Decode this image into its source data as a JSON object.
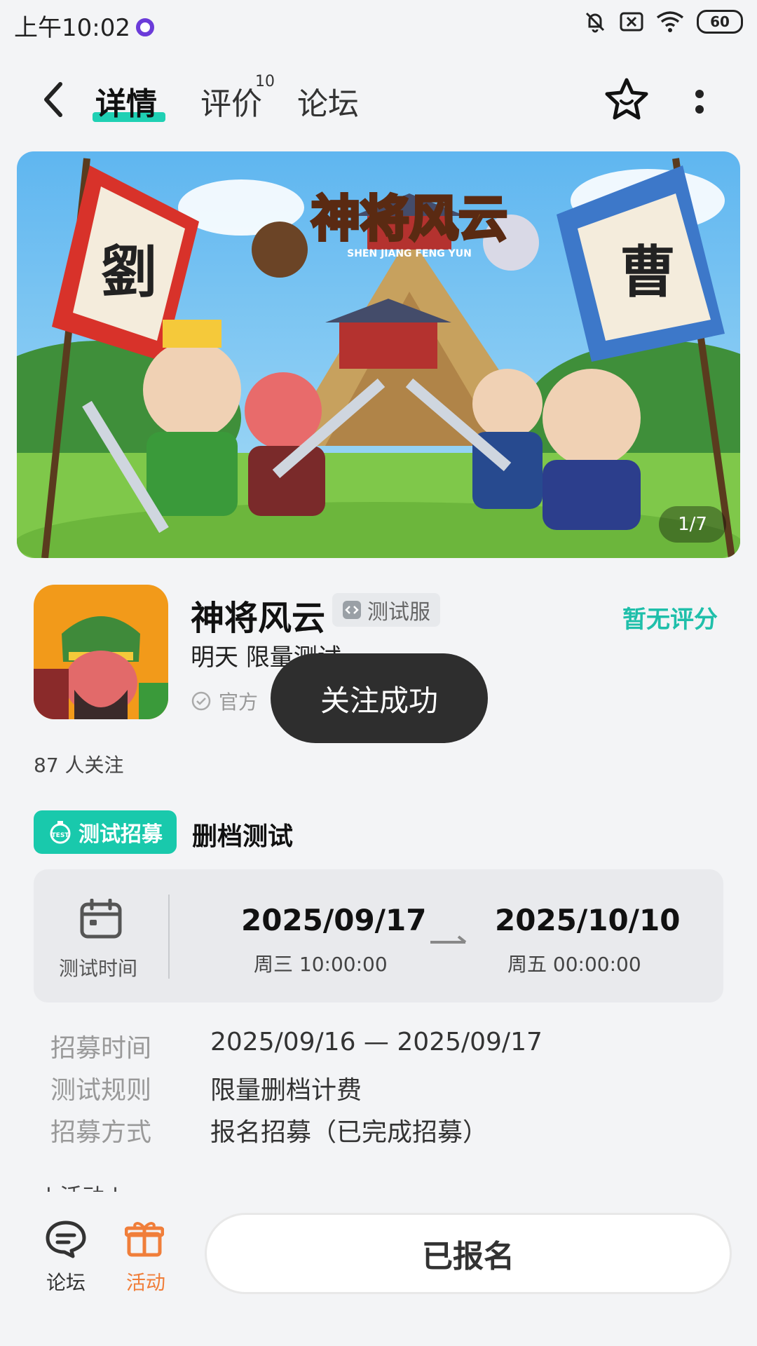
{
  "status_bar": {
    "time": "上午10:02",
    "battery": "60"
  },
  "nav": {
    "tabs": [
      {
        "label": "详情"
      },
      {
        "label": "评价",
        "badge": "10"
      },
      {
        "label": "论坛"
      }
    ]
  },
  "banner": {
    "game_logo_text": "神将风云",
    "game_logo_sub": "SHEN JIANG FENG YUN",
    "flag_left": "劉",
    "flag_right": "曹",
    "counter": "1/7"
  },
  "app": {
    "title": "神将风云",
    "tag": "测试服",
    "rating": "暂无评分",
    "schedule": "明天 限量测试",
    "official": "官方",
    "followers": "87 人关注"
  },
  "toast": "关注成功",
  "recruit": {
    "badge": "测试招募",
    "type": "删档测试",
    "time_label": "测试时间",
    "start_date": "2025/09/17",
    "start_detail": "周三  10:00:00",
    "end_date": "2025/10/10",
    "end_detail": "周五  00:00:00",
    "rows": [
      {
        "key": "招募时间",
        "value": "2025/09/16 — 2025/09/17"
      },
      {
        "key": "测试规则",
        "value": "限量删档计费"
      },
      {
        "key": "招募方式",
        "value": "报名招募（已完成招募）"
      }
    ]
  },
  "partial_heading": "| 活动 |",
  "bottom_bar": {
    "forum_label": "论坛",
    "activity_label": "活动",
    "button_label": "已报名"
  },
  "colors": {
    "accent": "#1fd0b4",
    "activity": "#f07e3a",
    "toast_bg": "#2e2e2e"
  }
}
